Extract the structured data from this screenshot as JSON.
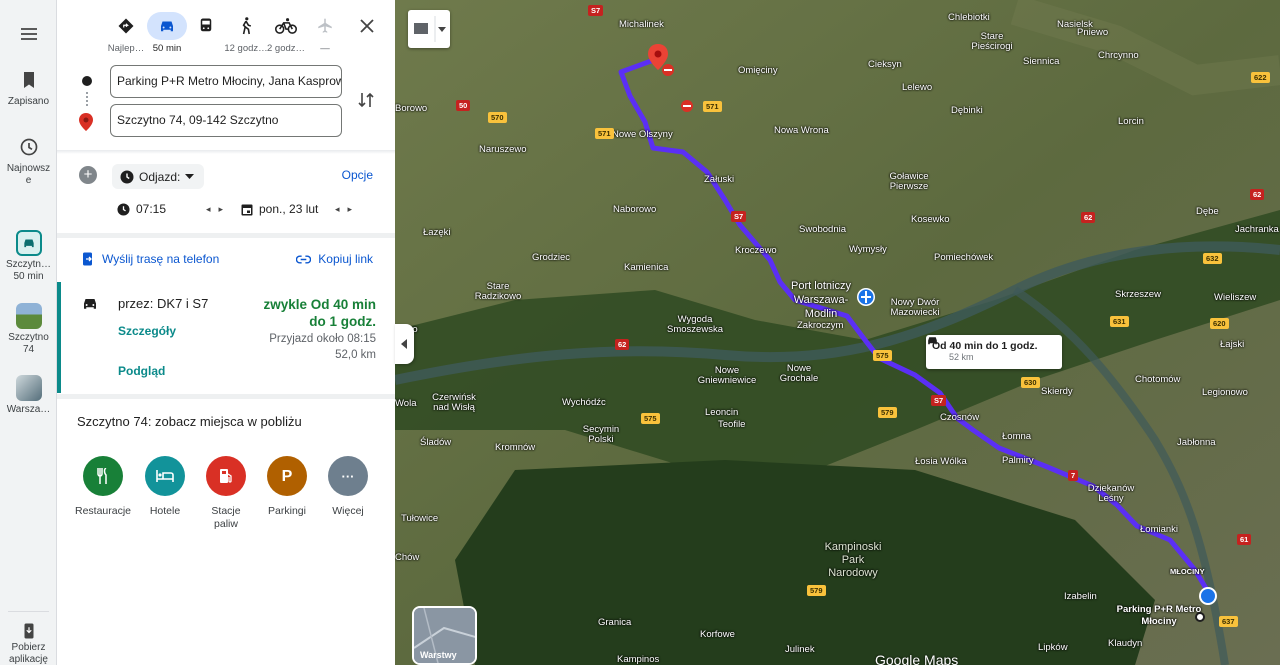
{
  "rail": {
    "menu_icon": "hamburger-icon",
    "saved": "Zapisano",
    "recent": "Najnowsze",
    "recent_items": [
      {
        "label": "Szczytn… 50 min",
        "icon": "car-icon"
      },
      {
        "label": "Szczytno 74",
        "icon": "photo-thumbnail"
      },
      {
        "label": "Warsza…",
        "icon": "photo-thumbnail"
      }
    ],
    "get_app": "Pobierz aplikację"
  },
  "modes": [
    {
      "label": "Najlep…",
      "icon": "best-route-icon",
      "active": false
    },
    {
      "label": "50 min",
      "icon": "car-icon",
      "active": true
    },
    {
      "label": "",
      "icon": "transit-icon",
      "active": false
    },
    {
      "label": "12 godz…",
      "icon": "walk-icon",
      "active": false
    },
    {
      "label": "2 godz…",
      "icon": "bike-icon",
      "active": false
    },
    {
      "label": "—",
      "icon": "plane-icon",
      "active": false
    }
  ],
  "origin": "Parking P+R Metro Młociny, Jana Kasprowicza",
  "destination": "Szczytno 74, 09-142 Szczytno",
  "departure": {
    "label": "Odjazd:",
    "time": "07:15",
    "date": "pon., 23 lut",
    "options": "Opcje"
  },
  "actions": {
    "send": "Wyślij trasę na telefon",
    "copy": "Kopiuj link"
  },
  "route": {
    "via": "przez: DK7 i S7",
    "duration": "zwykle Od 40 min do 1 godz.",
    "details": "Szczegóły",
    "arrival": "Przyjazd około 08:15",
    "distance": "52,0 km",
    "preview": "Podgląd"
  },
  "nearby": {
    "title": "Szczytno 74: zobacz miejsca w pobliżu",
    "categories": [
      {
        "label": "Restauracje",
        "color": "#188038",
        "icon": "restaurant-icon"
      },
      {
        "label": "Hotele",
        "color": "#12939a",
        "icon": "hotel-icon"
      },
      {
        "label": "Stacje paliw",
        "color": "#d93025",
        "icon": "gas-station-icon"
      },
      {
        "label": "Parkingi",
        "color": "#b06000",
        "icon": "parking-icon"
      },
      {
        "label": "Więcej",
        "color": "#6e7f8e",
        "icon": "more-icon"
      }
    ]
  },
  "map": {
    "popup_time": "Od 40 min do 1 godz.",
    "popup_distance": "52 km",
    "layers": "Warstwy",
    "brand": "Google Maps",
    "route_color": "#5b2ff5",
    "labels": [
      {
        "text": "Michalinek"
      },
      {
        "text": "Omięciny"
      },
      {
        "text": "Cieksyn"
      },
      {
        "text": "Chlebiotki"
      },
      {
        "text": "Stare Pieścirogi"
      },
      {
        "text": "Nasielsk"
      },
      {
        "text": "Pniewo"
      },
      {
        "text": "Chrcynno"
      },
      {
        "text": "Lelewo"
      },
      {
        "text": "Siennica"
      },
      {
        "text": "Borowo"
      },
      {
        "text": "Nowe Olszyny"
      },
      {
        "text": "Dębinki"
      },
      {
        "text": "Lorcin"
      },
      {
        "text": "Naruszewo"
      },
      {
        "text": "Nowa Wrona"
      },
      {
        "text": "Załuski"
      },
      {
        "text": "Goławice Pierwsze"
      },
      {
        "text": "Naborowo"
      },
      {
        "text": "Kosewko"
      },
      {
        "text": "Dębe"
      },
      {
        "text": "Jachranka"
      },
      {
        "text": "Łazęki"
      },
      {
        "text": "Swobodnia"
      },
      {
        "text": "Wymysły"
      },
      {
        "text": "Kroczewo"
      },
      {
        "text": "Pomiechówek"
      },
      {
        "text": "Grodziec"
      },
      {
        "text": "Kamienica"
      },
      {
        "text": "Stare Radzikowo"
      },
      {
        "text": "Port lotniczy Warszawa-Modlin"
      },
      {
        "text": "Nowy Dwór Mazowiecki"
      },
      {
        "text": "Skrzeszew"
      },
      {
        "text": "Wieliszew"
      },
      {
        "text": "Wygoda Smoszewska"
      },
      {
        "text": "Zakroczym"
      },
      {
        "text": "Łajski"
      },
      {
        "text": "Nowe Gniewniewice"
      },
      {
        "text": "Nowe Grochale"
      },
      {
        "text": "Chotomów"
      },
      {
        "text": "Legionowo"
      },
      {
        "text": "Czerwińsk nad Wisłą"
      },
      {
        "text": "Wychódźc"
      },
      {
        "text": "Leoncin"
      },
      {
        "text": "Teofile"
      },
      {
        "text": "Skierdy"
      },
      {
        "text": "Czosnów"
      },
      {
        "text": "Łomna"
      },
      {
        "text": "Secymin Polski"
      },
      {
        "text": "Śladów"
      },
      {
        "text": "Kromnów"
      },
      {
        "text": "Łosia Wólka"
      },
      {
        "text": "Palmiry"
      },
      {
        "text": "Jabłonna"
      },
      {
        "text": "Dziekanów Leśny"
      },
      {
        "text": "Tułowice"
      },
      {
        "text": "Łomianki"
      },
      {
        "text": "Kampinoski Park Narodowy"
      },
      {
        "text": "MŁOCINY"
      },
      {
        "text": "Izabelin"
      },
      {
        "text": "Parking P+R Metro Młociny"
      },
      {
        "text": "Granica"
      },
      {
        "text": "Korfowe"
      },
      {
        "text": "Julinek"
      },
      {
        "text": "Kampinos"
      },
      {
        "text": "Lipków"
      },
      {
        "text": "Klaudyn"
      },
      {
        "text": "Wola"
      },
      {
        "text": "Lewo"
      },
      {
        "text": "Chów"
      }
    ],
    "shields": [
      {
        "text": "S7",
        "style": "red"
      },
      {
        "text": "571",
        "style": "yellow"
      },
      {
        "text": "570",
        "style": "yellow"
      },
      {
        "text": "50",
        "style": "red"
      },
      {
        "text": "S7",
        "style": "red"
      },
      {
        "text": "62",
        "style": "red"
      },
      {
        "text": "62",
        "style": "red"
      },
      {
        "text": "632",
        "style": "yellow"
      },
      {
        "text": "575",
        "style": "yellow"
      },
      {
        "text": "S7",
        "style": "red"
      },
      {
        "text": "630",
        "style": "yellow"
      },
      {
        "text": "579",
        "style": "yellow"
      },
      {
        "text": "7",
        "style": "red"
      },
      {
        "text": "575",
        "style": "yellow"
      },
      {
        "text": "579",
        "style": "yellow"
      },
      {
        "text": "61",
        "style": "red"
      },
      {
        "text": "637",
        "style": "yellow"
      },
      {
        "text": "571",
        "style": "yellow"
      },
      {
        "text": "622",
        "style": "yellow"
      },
      {
        "text": "620",
        "style": "yellow"
      },
      {
        "text": "631",
        "style": "yellow"
      },
      {
        "text": "62",
        "style": "red"
      }
    ]
  }
}
